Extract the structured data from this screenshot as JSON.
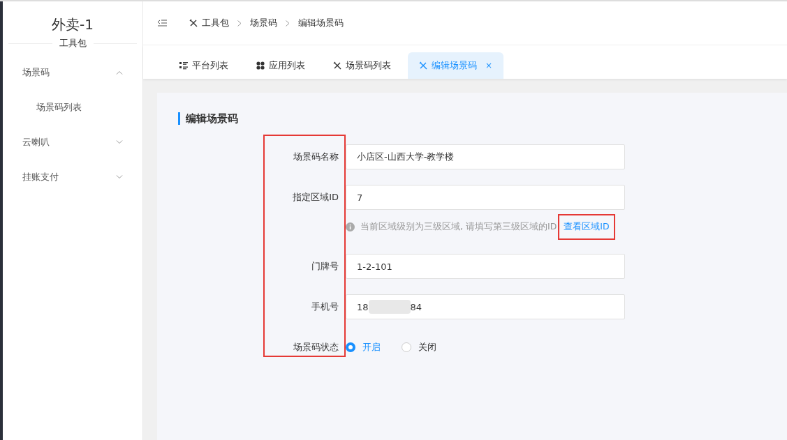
{
  "sidebar": {
    "title": "外卖-1",
    "subtitle": "工具包",
    "items": [
      {
        "label": "场景码",
        "expanded": true,
        "children": [
          {
            "label": "场景码列表"
          }
        ]
      },
      {
        "label": "云喇叭",
        "expanded": false
      },
      {
        "label": "挂账支付",
        "expanded": false
      }
    ]
  },
  "breadcrumb": [
    "工具包",
    "场景码",
    "编辑场景码"
  ],
  "tabs": [
    {
      "label": "平台列表",
      "selected": false
    },
    {
      "label": "应用列表",
      "selected": false
    },
    {
      "label": "场景码列表",
      "selected": false
    },
    {
      "label": "编辑场景码",
      "selected": true,
      "close": "×"
    }
  ],
  "form": {
    "title": "编辑场景码",
    "labels_highlighted": true,
    "fields": [
      {
        "kind": "input",
        "label": "场景码名称",
        "value": "小店区-山西大学-教学楼"
      },
      {
        "kind": "input",
        "label": "指定区域ID",
        "value": "7",
        "hint": "当前区域级别为三级区域, 请填写第三级区域的ID",
        "link": "查看区域ID",
        "link_highlighted": true
      },
      {
        "kind": "input",
        "label": "门牌号",
        "value": "1-2-101"
      },
      {
        "kind": "masked",
        "label": "手机号",
        "prefix": "18",
        "suffix": "84"
      },
      {
        "kind": "radio",
        "label": "场景码状态",
        "options": [
          {
            "label": "开启",
            "selected": true
          },
          {
            "label": "关闭",
            "selected": false
          }
        ]
      }
    ]
  }
}
